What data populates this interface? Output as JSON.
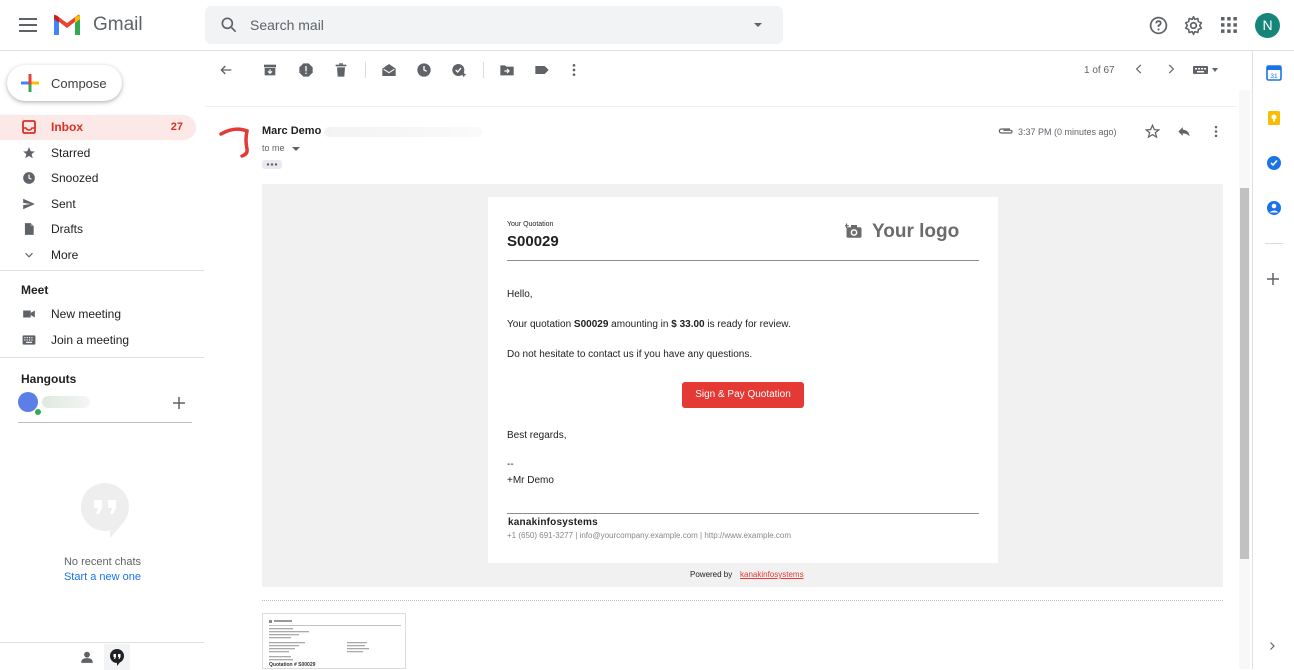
{
  "app": {
    "name": "Gmail",
    "avatar_letter": "N"
  },
  "search": {
    "placeholder": "Search mail"
  },
  "sidebar": {
    "compose_label": "Compose",
    "items": [
      {
        "label": "Inbox",
        "count": "27",
        "icon": "inbox-icon"
      },
      {
        "label": "Starred",
        "icon": "star-icon"
      },
      {
        "label": "Snoozed",
        "icon": "clock-icon"
      },
      {
        "label": "Sent",
        "icon": "send-icon"
      },
      {
        "label": "Drafts",
        "icon": "draft-icon"
      },
      {
        "label": "More",
        "icon": "chevron-down-icon"
      }
    ],
    "meet": {
      "title": "Meet",
      "new_meeting": "New meeting",
      "join_meeting": "Join a meeting"
    },
    "hangouts": {
      "title": "Hangouts",
      "no_chats": "No recent chats",
      "start_chat": "Start a new one"
    }
  },
  "toolbar": {
    "page_count": "1 of 67"
  },
  "email": {
    "sender_name": "Marc Demo",
    "recipient": "to me",
    "time": "3:37 PM (0 minutes ago)",
    "body": {
      "quote_label": "Your Quotation",
      "quote_number": "S00029",
      "logo_text": "Your logo",
      "greeting": "Hello,",
      "line1_prefix": "Your quotation ",
      "line1_number": "S00029",
      "line1_mid": " amounting in ",
      "line1_amount": "$ 33.00",
      "line1_suffix": " is ready for review.",
      "line2": "Do not hesitate to contact us if you have any questions.",
      "cta": "Sign & Pay Quotation",
      "regards": "Best regards,",
      "sig_dashes": "--",
      "sig_name": "+Mr Demo",
      "company": "kanakinfosystems",
      "contact": "+1 (650) 691-3277 | info@yourcompany.example.com | http://www.example.com",
      "powered_by": "Powered by",
      "powered_link": "kanakinfosystems"
    },
    "attachment": {
      "title_line": "Quotation # S00029"
    }
  },
  "colors": {
    "accent_red": "#d93025",
    "inbox_bg": "#fce8e6",
    "button_red": "#e53935",
    "link_blue": "#1a73e8"
  }
}
